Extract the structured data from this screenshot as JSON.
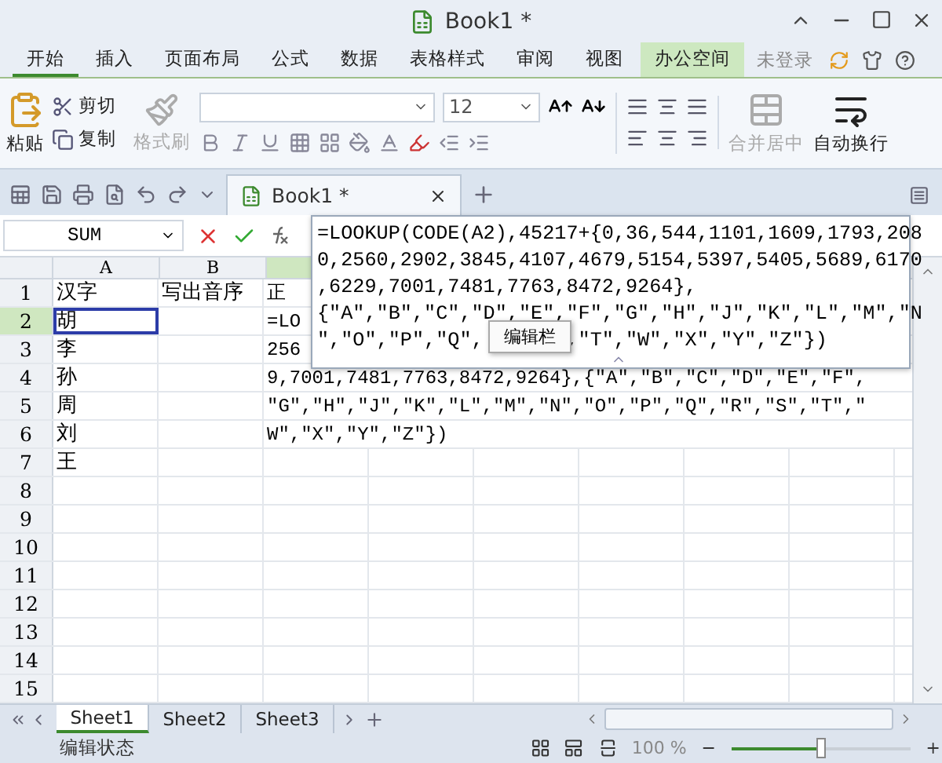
{
  "window": {
    "title": "Book1 *"
  },
  "menu_tabs": [
    {
      "label": "开始",
      "selected": true,
      "highlighted": false
    },
    {
      "label": "插入",
      "selected": false,
      "highlighted": false
    },
    {
      "label": "页面布局",
      "selected": false,
      "highlighted": false
    },
    {
      "label": "公式",
      "selected": false,
      "highlighted": false
    },
    {
      "label": "数据",
      "selected": false,
      "highlighted": false
    },
    {
      "label": "表格样式",
      "selected": false,
      "highlighted": false
    },
    {
      "label": "审阅",
      "selected": false,
      "highlighted": false
    },
    {
      "label": "视图",
      "selected": false,
      "highlighted": false
    },
    {
      "label": "办公空间",
      "selected": false,
      "highlighted": true
    }
  ],
  "account": "未登录",
  "ribbon": {
    "paste": "粘贴",
    "cut": "剪切",
    "copy": "复制",
    "format_painter": {
      "label": "格式刷",
      "disabled": true
    },
    "font_size": "12",
    "merge": {
      "label": "合并居中",
      "disabled": true
    },
    "wrap": {
      "label": "自动换行",
      "disabled": false
    }
  },
  "doc_tabs": [
    {
      "label": "Book1 *",
      "selected": true
    }
  ],
  "formula_bar": {
    "name_box": "SUM",
    "formula_lines": [
      [
        "=LOOKUP(CODE(A2),45217+{0,36,544,1101,1609,1793,208"
      ],
      [
        "0,2560,2902,3845,4107,4679,5154,5397,5405,5689,6170"
      ],
      [
        ",6229,7001,7481,7763,8472,9264},"
      ],
      [
        "{\"A\",\"B\",\"C\",\"D\",\"E\",\"F\",\"G\",\"H\",\"J\",\"K\",\"L\",\"M\",\"N"
      ],
      [
        "\",\"O\",\"P\",\"Q\",",
        ",\"T\",\"W\",\"X\",\"Y\",\"Z\"})"
      ]
    ],
    "tooltip": "编辑栏"
  },
  "columns": [
    {
      "label": "A",
      "selected": false
    },
    {
      "label": "B",
      "selected": false
    },
    {
      "selected": true
    }
  ],
  "rows": [
    {
      "number": "1",
      "selected": false,
      "cells": [
        {
          "text": "汉字",
          "active": false
        },
        {
          "text": "写出音序",
          "active": false
        },
        {
          "text": "正",
          "active": false
        }
      ]
    },
    {
      "number": "2",
      "selected": true,
      "cells": [
        {
          "text": "胡",
          "active": true
        },
        {
          "active": false
        },
        {
          "text": "=LO",
          "active": false
        }
      ]
    },
    {
      "number": "3",
      "selected": false,
      "cells": [
        {
          "text": "李",
          "active": false
        },
        {
          "active": false
        },
        {
          "text": "256",
          "active": false
        }
      ]
    },
    {
      "number": "4",
      "selected": false,
      "cells": [
        {
          "text": "孙",
          "active": false
        },
        {
          "active": false
        },
        {
          "text": "9,7001,7481,7763,8472,9264},{\"A\",\"B\",\"C\",\"D\",\"E\",\"F\",",
          "active": false
        }
      ]
    },
    {
      "number": "5",
      "selected": false,
      "cells": [
        {
          "text": "周",
          "active": false
        },
        {
          "active": false
        },
        {
          "text": "\"G\",\"H\",\"J\",\"K\",\"L\",\"M\",\"N\",\"O\",\"P\",\"Q\",\"R\",\"S\",\"T\",\"",
          "active": false
        }
      ]
    },
    {
      "number": "6",
      "selected": false,
      "cells": [
        {
          "text": "刘",
          "active": false
        },
        {
          "active": false
        },
        {
          "text": "W\",\"X\",\"Y\",\"Z\"})",
          "active": false
        }
      ]
    },
    {
      "number": "7",
      "selected": false,
      "cells": [
        {
          "text": "王",
          "active": false
        }
      ]
    },
    {
      "number": "8",
      "selected": false
    },
    {
      "number": "9",
      "selected": false
    },
    {
      "number": "10",
      "selected": false
    },
    {
      "number": "11",
      "selected": false
    },
    {
      "number": "12",
      "selected": false
    },
    {
      "number": "13",
      "selected": false
    },
    {
      "number": "14",
      "selected": false
    },
    {
      "number": "15",
      "selected": false
    }
  ],
  "sheet_tabs": [
    {
      "label": "Sheet1",
      "selected": true
    },
    {
      "label": "Sheet2",
      "selected": false
    },
    {
      "label": "Sheet3",
      "selected": false
    }
  ],
  "status_bar": {
    "mode": "编辑状态",
    "zoom": "100 %",
    "level": 0.5
  }
}
